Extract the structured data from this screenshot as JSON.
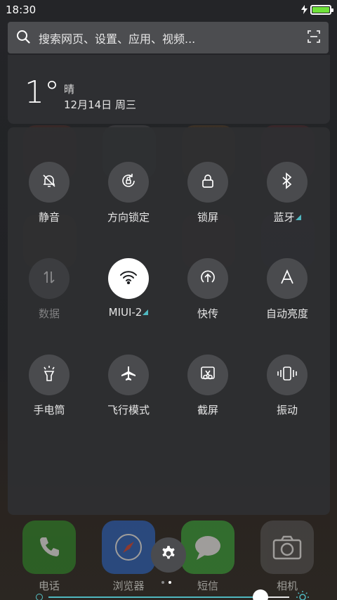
{
  "status": {
    "time": "18:30",
    "battery_level": 1.0,
    "battery_color": "#6fe23a",
    "charging_icon": "charging-bolt-icon"
  },
  "search": {
    "placeholder": "搜索网页、设置、应用、视频...",
    "icon": "search-icon",
    "scan_icon": "scan-icon"
  },
  "weather": {
    "temperature": "1°",
    "condition": "晴",
    "date": "12月14日 周三"
  },
  "toggles": [
    {
      "label": "静音",
      "icon": "mute-bell-icon",
      "state": "off"
    },
    {
      "label": "方向锁定",
      "icon": "rotation-lock-icon",
      "state": "off"
    },
    {
      "label": "锁屏",
      "icon": "lock-icon",
      "state": "off"
    },
    {
      "label": "蓝牙",
      "icon": "bluetooth-icon",
      "state": "off",
      "has_more": true
    },
    {
      "label": "数据",
      "icon": "mobile-data-icon",
      "state": "disabled"
    },
    {
      "label": "MIUI-2",
      "icon": "wifi-icon",
      "state": "on",
      "has_more": true
    },
    {
      "label": "快传",
      "icon": "quick-transfer-icon",
      "state": "off"
    },
    {
      "label": "自动亮度",
      "icon": "auto-brightness-icon",
      "state": "off"
    },
    {
      "label": "手电筒",
      "icon": "flashlight-icon",
      "state": "off"
    },
    {
      "label": "飞行模式",
      "icon": "airplane-icon",
      "state": "off"
    },
    {
      "label": "截屏",
      "icon": "screenshot-icon",
      "state": "off"
    },
    {
      "label": "振动",
      "icon": "vibrate-icon",
      "state": "off"
    }
  ],
  "brightness": {
    "level": 0.88,
    "accent": "#4fb8c0"
  },
  "dock": [
    {
      "label": "电话",
      "icon": "phone-icon",
      "color": "#2f8f2a"
    },
    {
      "label": "浏览器",
      "icon": "compass-icon",
      "color": "#2a67c9"
    },
    {
      "label": "短信",
      "icon": "message-icon",
      "color": "#3aa83a"
    },
    {
      "label": "相机",
      "icon": "camera-icon",
      "color": "#555555"
    }
  ],
  "pager": {
    "pages": 2,
    "current": 2
  }
}
